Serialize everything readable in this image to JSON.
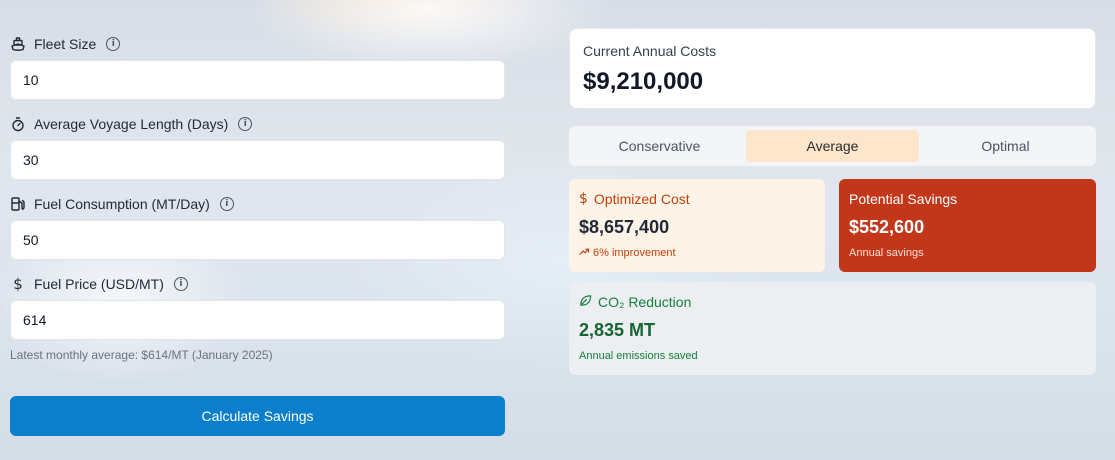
{
  "form": {
    "fleet_size": {
      "label": "Fleet Size",
      "value": "10",
      "icon": "ship-icon"
    },
    "voyage_length": {
      "label": "Average Voyage Length (Days)",
      "value": "30",
      "icon": "stopwatch-icon"
    },
    "fuel_consumption": {
      "label": "Fuel Consumption (MT/Day)",
      "value": "50",
      "icon": "fuel-pump-icon"
    },
    "fuel_price": {
      "label": "Fuel Price (USD/MT)",
      "value": "614",
      "icon": "dollar-icon"
    },
    "hint": "Latest monthly average: $614/MT (January 2025)",
    "submit_label": "Calculate Savings"
  },
  "summary": {
    "current_costs_title": "Current Annual Costs",
    "current_costs_value": "$9,210,000"
  },
  "tabs": [
    {
      "label": "Conservative",
      "active": false
    },
    {
      "label": "Average",
      "active": true
    },
    {
      "label": "Optimal",
      "active": false
    }
  ],
  "optimized": {
    "title": "Optimized Cost",
    "value": "$8,657,400",
    "sub": "6% improvement"
  },
  "savings": {
    "title": "Potential Savings",
    "value": "$552,600",
    "sub": "Annual savings"
  },
  "co2": {
    "title": "CO₂ Reduction",
    "value": "2,835 MT",
    "sub": "Annual emissions saved"
  },
  "colors": {
    "primary_button": "#0b7fcc",
    "active_tab": "#fde6cc",
    "optimized_bg": "#fdf3e7",
    "optimized_accent": "#c2410c",
    "savings_bg": "#c2361a",
    "co2_accent": "#15803d"
  }
}
